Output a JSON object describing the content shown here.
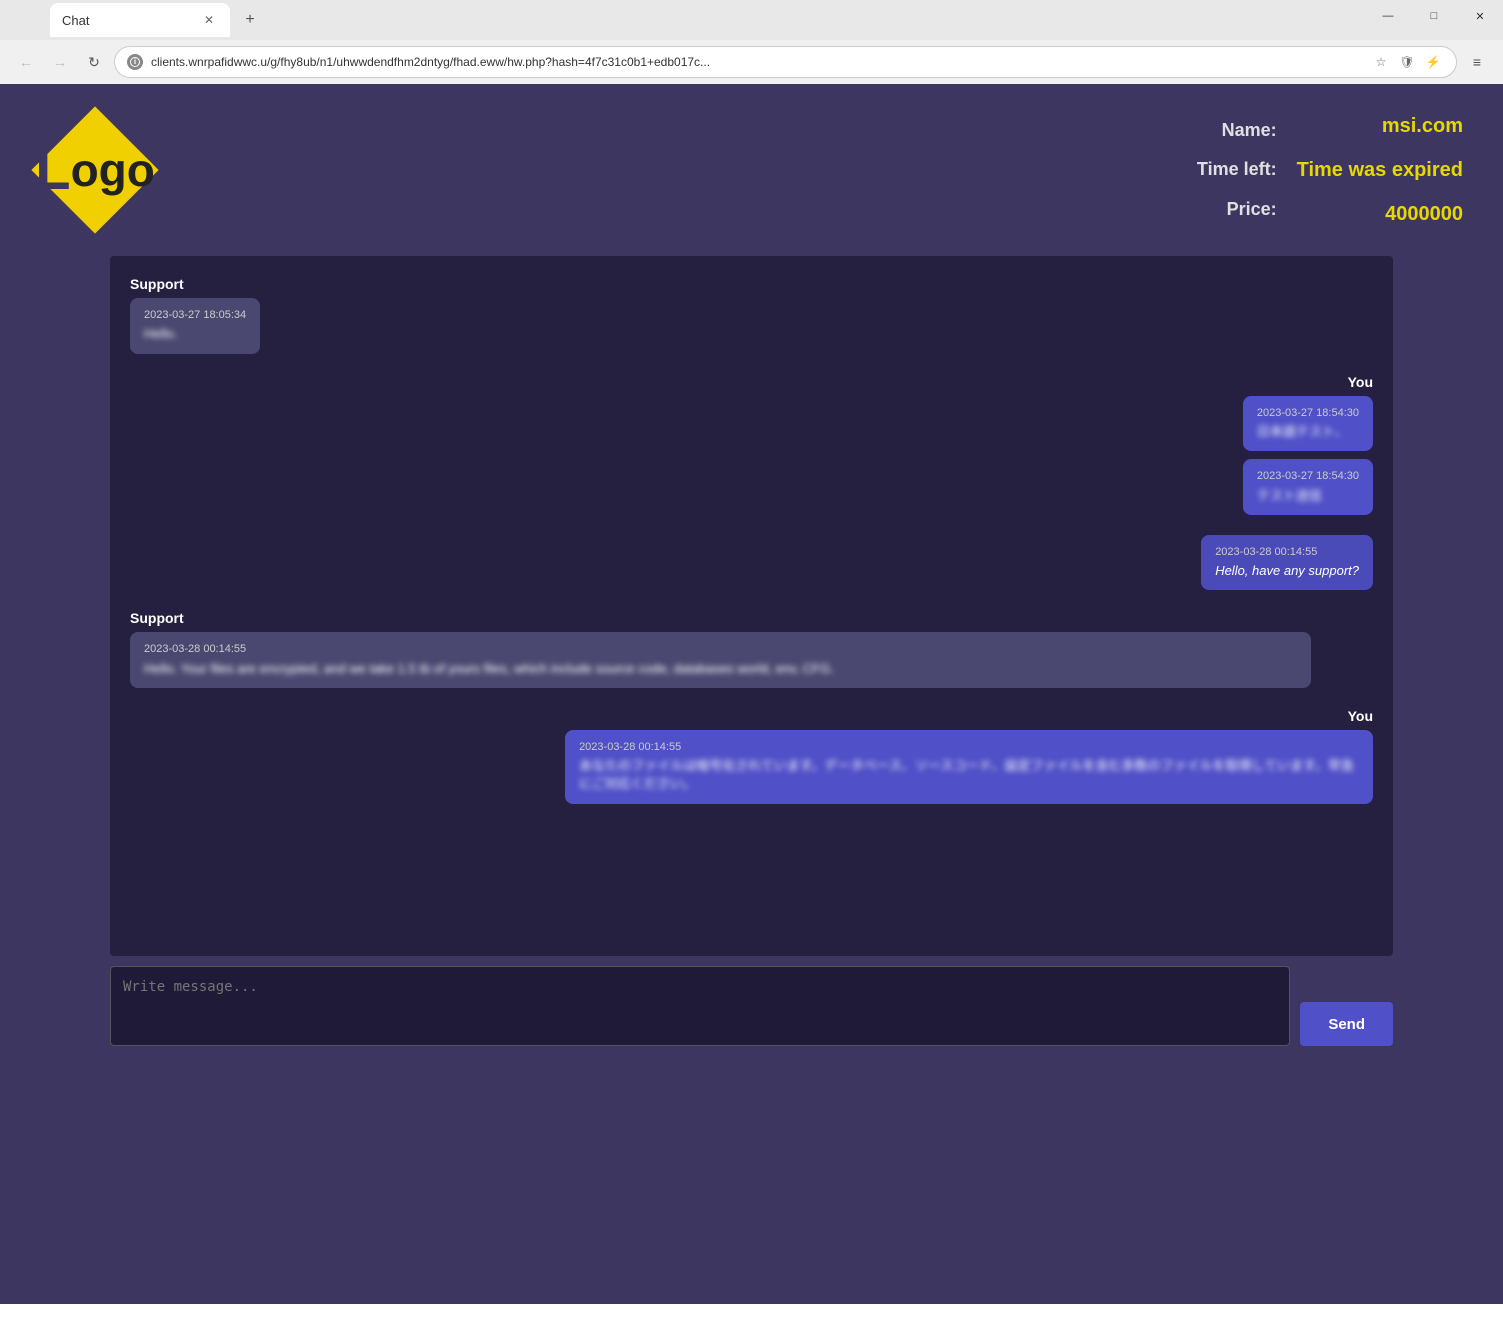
{
  "browser": {
    "tab_title": "Chat",
    "address": "clients.wnrpafidwwc.u/g/fhy8ub/n1/uhwwdendfhm2dntyg/fhad.eww/hw.php?hash=4f7c31c0b1+edb017c...",
    "new_tab_label": "+",
    "close_label": "✕",
    "back_label": "←",
    "forward_label": "→",
    "refresh_label": "↻",
    "star_label": "☆",
    "shield_label": "🛡",
    "extensions_label": "⚡",
    "menu_label": "≡",
    "win_minimize": "—",
    "win_maximize": "□",
    "win_close": "✕"
  },
  "header": {
    "logo_letter": "L",
    "logo_word": "ogo",
    "name_label": "Name:",
    "time_label": "Time left:",
    "price_label": "Price:",
    "name_value": "msi.com",
    "time_value": "Time was expired",
    "price_value": "4000000"
  },
  "chat": {
    "messages": [
      {
        "sender": "Support",
        "side": "left",
        "bubbles": [
          {
            "time": "2023-03-27 18:05:34",
            "text": "Hello."
          }
        ]
      },
      {
        "sender": "You",
        "side": "right",
        "bubbles": [
          {
            "time": "2023-03-27 18:54:30",
            "text": "日本語テスト、"
          },
          {
            "time": "2023-03-27 18:54:30",
            "text": "テスト送信"
          }
        ]
      },
      {
        "sender": "",
        "side": "right",
        "bubbles": [
          {
            "time": "2023-03-28 00:14:55",
            "text": "Hello, have any support?"
          }
        ]
      },
      {
        "sender": "Support",
        "side": "left",
        "bubbles": [
          {
            "time": "2023-03-28 00:14:55",
            "text": "Hello. Your files are encrypted, and we take 1.5 tb of yours files, which include source code, databases world, env, CFG."
          }
        ]
      },
      {
        "sender": "You",
        "side": "right",
        "bubbles": [
          {
            "time": "2023-03-28 00:14:55",
            "text": "あなたのファイルは暗号化されています。データベース、ソースコード、設定ファイルを含む多数のファイルを取得しています。早急にご対応ください。"
          }
        ]
      }
    ],
    "input_placeholder": "Write message...",
    "send_label": "Send"
  }
}
